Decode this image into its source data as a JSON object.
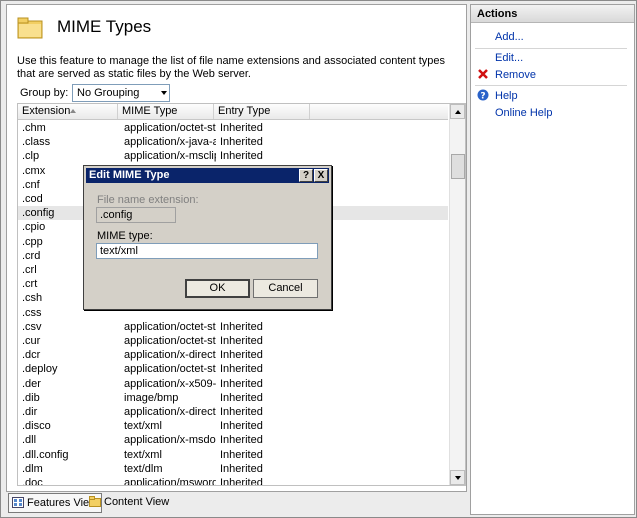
{
  "page": {
    "title": "MIME Types",
    "description": "Use this feature to manage the list of file name extensions and associated content types that are served as static files by the Web server.",
    "group_by_label": "Group by:",
    "group_by_value": "No Grouping"
  },
  "table": {
    "columns": [
      "Extension",
      "MIME Type",
      "Entry Type"
    ],
    "rows": [
      [
        ".chm",
        "application/octet-st...",
        "Inherited"
      ],
      [
        ".class",
        "application/x-java-a...",
        "Inherited"
      ],
      [
        ".clp",
        "application/x-msclip",
        "Inherited"
      ],
      [
        ".cmx",
        "",
        ""
      ],
      [
        ".cnf",
        "",
        ""
      ],
      [
        ".cod",
        "",
        ""
      ],
      [
        ".config",
        "",
        ""
      ],
      [
        ".cpio",
        "",
        ""
      ],
      [
        ".cpp",
        "",
        ""
      ],
      [
        ".crd",
        "",
        ""
      ],
      [
        ".crl",
        "",
        ""
      ],
      [
        ".crt",
        "",
        ""
      ],
      [
        ".csh",
        "",
        ""
      ],
      [
        ".css",
        "",
        ""
      ],
      [
        ".csv",
        "application/octet-st...",
        "Inherited"
      ],
      [
        ".cur",
        "application/octet-st...",
        "Inherited"
      ],
      [
        ".dcr",
        "application/x-director",
        "Inherited"
      ],
      [
        ".deploy",
        "application/octet-st...",
        "Inherited"
      ],
      [
        ".der",
        "application/x-x509-...",
        "Inherited"
      ],
      [
        ".dib",
        "image/bmp",
        "Inherited"
      ],
      [
        ".dir",
        "application/x-director",
        "Inherited"
      ],
      [
        ".disco",
        "text/xml",
        "Inherited"
      ],
      [
        ".dll",
        "application/x-msdo...",
        "Inherited"
      ],
      [
        ".dll.config",
        "text/xml",
        "Inherited"
      ],
      [
        ".dlm",
        "text/dlm",
        "Inherited"
      ],
      [
        ".doc",
        "application/msword",
        "Inherited"
      ]
    ],
    "selected_index": 6
  },
  "bottom_tabs": [
    "Features View",
    "Content View"
  ],
  "actions": {
    "header": "Actions",
    "items": [
      "Add...",
      "Edit...",
      "Remove",
      "Help",
      "Online Help"
    ]
  },
  "dialog": {
    "title": "Edit MIME Type",
    "help_glyph": "?",
    "close_glyph": "X",
    "ext_label": "File name extension:",
    "ext_value": ".config",
    "mime_label": "MIME type:",
    "mime_value": "text/xml",
    "ok_label": "OK",
    "cancel_label": "Cancel"
  }
}
